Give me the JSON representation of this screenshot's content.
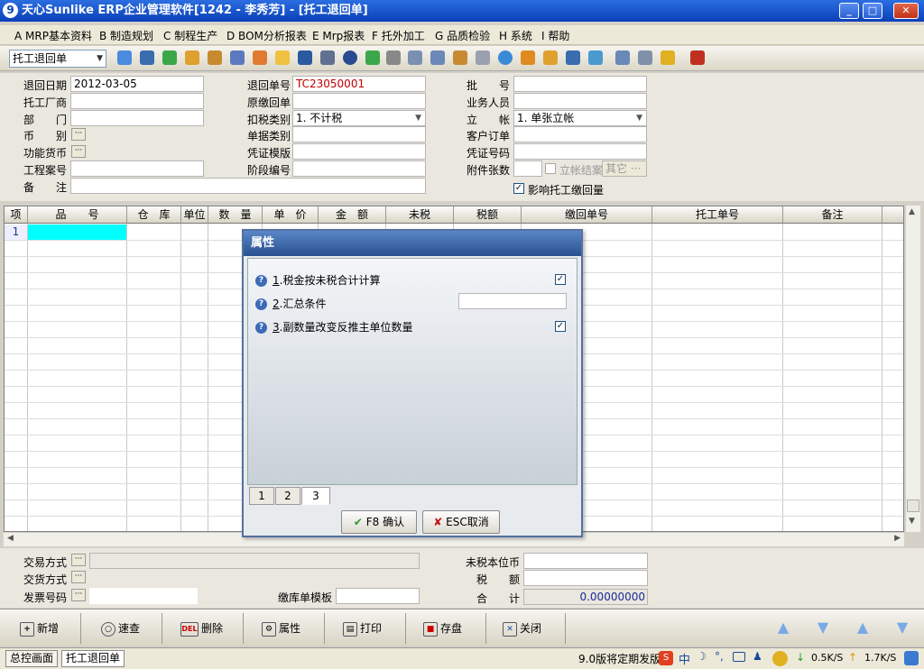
{
  "window": {
    "logo": "9",
    "title": "天心Sunlike ERP企业管理软件[1242 - 李秀芳] - [托工退回单]",
    "min": "_",
    "max": "□",
    "close": "✕"
  },
  "menu": [
    "A MRP基本资料",
    "B 制造规划",
    "C 制程生产",
    "D BOM分析报表",
    "E Mrp报表",
    "F 托外加工",
    "G 品质检验",
    "H 系统",
    "I 帮助"
  ],
  "toolbar": {
    "combo_value": "托工退回单"
  },
  "form": {
    "return_date_label": "退回日期",
    "return_date_value": "2012-03-05",
    "vendor_label": "托工厂商",
    "dept_label": "部　　门",
    "currency_label": "币　　别",
    "func_currency_label": "功能货币",
    "project_label": "工程案号",
    "remark_label": "备　　注",
    "return_no_label": "退回单号",
    "return_no_value": "TC23050001",
    "orig_no_label": "原缴回单",
    "tax_type_label": "扣税类别",
    "tax_type_value": "1. 不计税",
    "doc_type_label": "单据类别",
    "voucher_tpl_label": "凭证模版",
    "stage_no_label": "阶段编号",
    "batch_label": "批　　号",
    "salesman_label": "业务人员",
    "account_label": "立　　帐",
    "account_value": "1. 单张立帐",
    "customer_order_label": "客户订单",
    "voucher_no_label": "凭证号码",
    "attach_label": "附件张数",
    "settle_label": "立帐结案",
    "other_label": "其它",
    "affect_label": "影响托工缴回量"
  },
  "grid": {
    "columns": [
      "项",
      "品　　号",
      "仓　库",
      "单位",
      "数　量",
      "单　价",
      "金　额",
      "未税",
      "税额",
      "缴回单号",
      "托工单号",
      "备注"
    ],
    "row_no": "1"
  },
  "footer": {
    "trade_label": "交易方式",
    "delivery_label": "交货方式",
    "invoice_label": "发票号码",
    "return_tpl_label": "缴库单模板",
    "untaxed_label": "未税本位币",
    "tax_label": "税　　额",
    "total_label": "合　　计",
    "total_value": "0.00000000"
  },
  "buttons": {
    "add": "新增",
    "query": "速查",
    "delete": "删除",
    "property": "属性",
    "print": "打印",
    "save": "存盘",
    "close": "关闭",
    "del_tag": "DEL"
  },
  "status": {
    "tab1": "总控画面",
    "tab2": "托工退回单",
    "notice": "9.0版将定期发版",
    "down": "0.5K/S",
    "up": "1.7K/S"
  },
  "dialog": {
    "title": "属性",
    "items": [
      {
        "key": "1",
        "label": ".税金按未税合计计算"
      },
      {
        "key": "2",
        "label": ".汇总条件"
      },
      {
        "key": "3",
        "label": ".副数量改变反推主单位数量"
      }
    ],
    "tabs": [
      "1",
      "2",
      "3"
    ],
    "ok": "F8 确认",
    "cancel": "ESC取消"
  },
  "colors": {
    "accent": "#0a3fb8",
    "selected_cell": "#00ffff",
    "doc_no": "#c00000"
  }
}
